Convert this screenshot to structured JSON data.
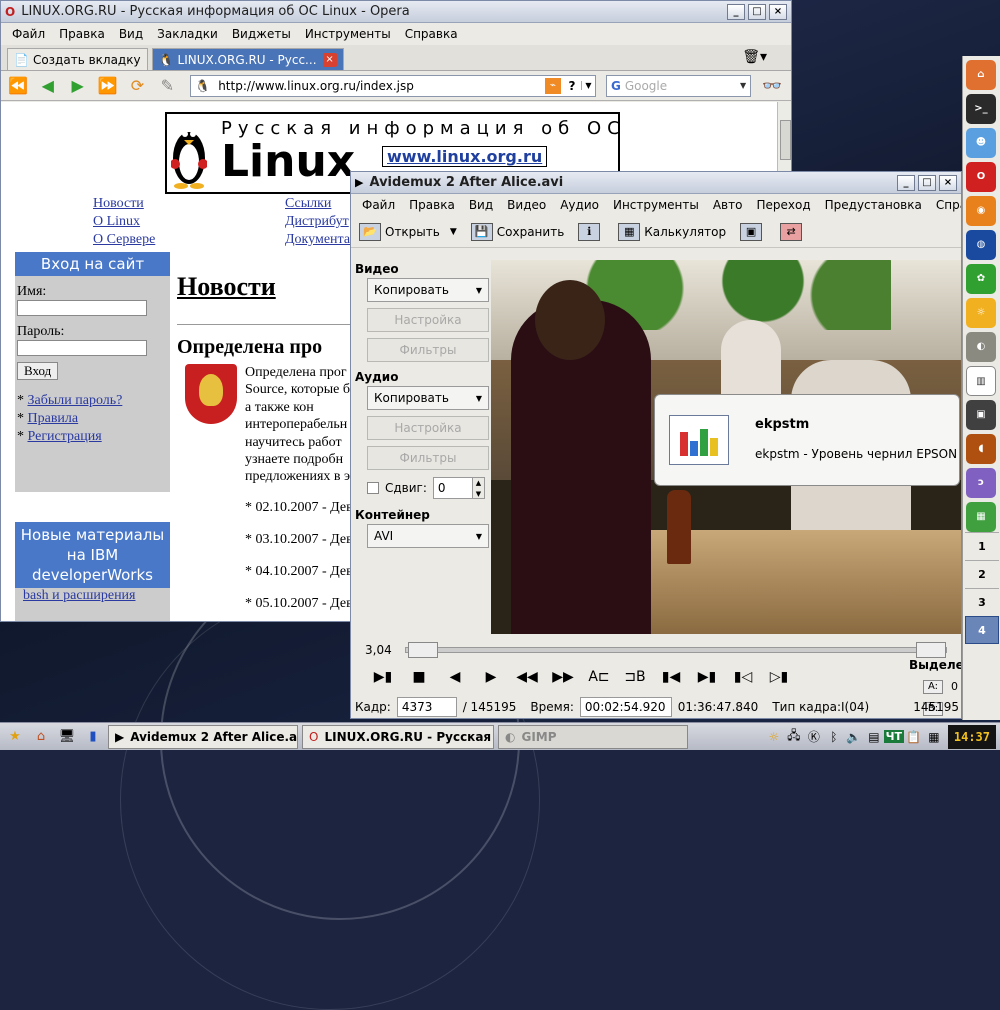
{
  "opera": {
    "title": "LINUX.ORG.RU - Русская информация об ОС Linux - Opera",
    "menu": [
      "Файл",
      "Правка",
      "Вид",
      "Закладки",
      "Виджеты",
      "Инструменты",
      "Справка"
    ],
    "tabs": {
      "new_tab": "Создать вкладку",
      "active": "LINUX.ORG.RU - Русс..."
    },
    "url": "http://www.linux.org.ru/index.jsp",
    "search_placeholder": "Google",
    "page": {
      "banner_top": "Русская информация об ОС",
      "banner_linux": "Linux",
      "banner_site": "www.linux.org.ru",
      "nav_left": [
        "Новости",
        "О Linux",
        "О Сервере"
      ],
      "nav_right": [
        "Ссылки",
        "Дистрибут",
        "Документа"
      ],
      "login": {
        "header": "Вход на сайт",
        "name_label": "Имя:",
        "password_label": "Пароль:",
        "button": "Вход",
        "links": [
          "Забыли пароль?",
          "Правила",
          "Регистрация"
        ]
      },
      "ibm": {
        "header": "Новые материалы на IBM developerWorks",
        "item": "bash и расширения"
      },
      "news_heading": "Новости",
      "article_heading": "Определена про",
      "article_text": [
        "Определена прог",
        "Source, которые б",
        "а также кон",
        "интероперабельн",
        "научитесь работ",
        "узнаете подробн",
        "предложениях в э"
      ],
      "dates": [
        "* 02.10.2007 - Дев",
        "* 03.10.2007 - Дев",
        "* 04.10.2007 - Дев",
        "* 05.10.2007 - Дев"
      ]
    }
  },
  "avidemux": {
    "title": "Avidemux 2 After Alice.avi",
    "menu": [
      "Файл",
      "Правка",
      "Вид",
      "Видео",
      "Аудио",
      "Инструменты",
      "Авто",
      "Переход",
      "Предустановка",
      "Справка"
    ],
    "toolbar": {
      "open": "Открыть",
      "save": "Сохранить",
      "calculator": "Калькулятор"
    },
    "video": {
      "header": "Видео",
      "codec": "Копировать",
      "config": "Настройка",
      "filters": "Фильтры"
    },
    "audio": {
      "header": "Аудио",
      "codec": "Копировать",
      "config": "Настройка",
      "filters": "Фильтры",
      "shift_label": "Сдвиг:",
      "shift_value": "0"
    },
    "container": {
      "header": "Контейнер",
      "format": "AVI"
    },
    "position": "3,04",
    "selection_label": "Выделе",
    "a_label": "A:",
    "b_label": "B:",
    "a_value": "0",
    "b_value": "145195",
    "status": {
      "frame_label": "Кадр:",
      "frame_value": "4373",
      "frame_total": "/ 145195",
      "time_label": "Время:",
      "time_value": "00:02:54.920",
      "duration": "01:36:47.840",
      "frame_type": "Тип кадра:I(04)"
    }
  },
  "notification": {
    "title": "ekpstm",
    "message": "ekpstm - Уровень чернил EPSON",
    "bar_colors": [
      "#d83030",
      "#3070d0",
      "#30a040",
      "#e8c020"
    ]
  },
  "right_panel": {
    "workspaces": [
      "1",
      "2",
      "3",
      "4"
    ],
    "active_workspace": "4"
  },
  "taskbar": {
    "tasks": [
      "Avidemux 2 After Alice.avi",
      "LINUX.ORG.RU - Русская информ",
      "GIMP"
    ],
    "keyboard_layout": "ЧТ",
    "clock": "14:37"
  }
}
